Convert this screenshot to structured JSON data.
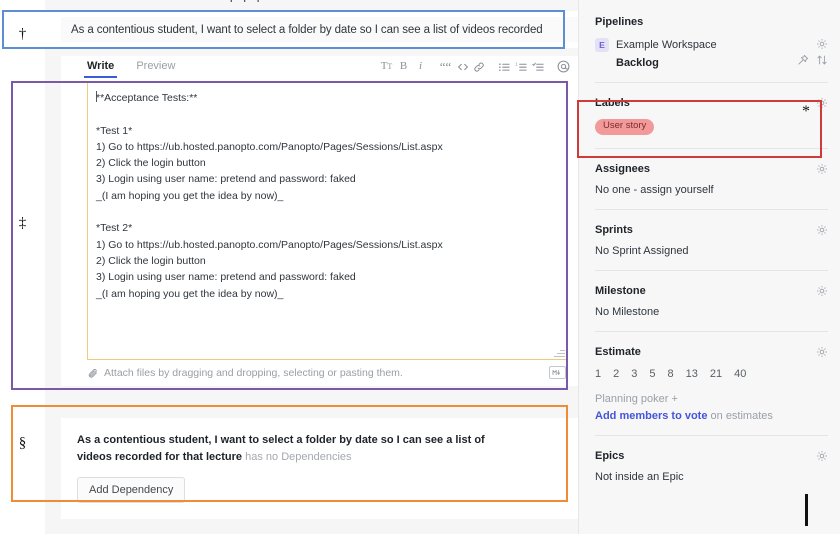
{
  "issue": {
    "title": "As a contentious student, I want to select a folder by date so I can see a list of videos recorded"
  },
  "editor": {
    "tabs": [
      {
        "label": "Write",
        "active": true
      },
      {
        "label": "Preview",
        "active": false
      }
    ],
    "toolbar": [
      {
        "name": "heading-icon",
        "glyph": "Tᴛ"
      },
      {
        "name": "bold-icon",
        "glyph": "B"
      },
      {
        "name": "italic-icon",
        "glyph": "i"
      },
      {
        "name": "quote-icon",
        "glyph": "““"
      },
      {
        "name": "code-icon",
        "glyph": "<>"
      },
      {
        "name": "link-icon",
        "glyph": "&"
      },
      {
        "name": "bulleted-list-icon",
        "glyph": "•≡"
      },
      {
        "name": "numbered-list-icon",
        "glyph": "1≡"
      },
      {
        "name": "task-list-icon",
        "glyph": "✓≡"
      },
      {
        "name": "mention-icon",
        "glyph": "@"
      }
    ],
    "body": "**Acceptance Tests:**\n\n*Test 1*\n1) Go to https://ub.hosted.panopto.com/Panopto/Pages/Sessions/List.aspx\n2) Click the login button\n3) Login using user name: pretend and password: faked\n_(I am hoping you get the idea by now)_\n\n*Test 2*\n1) Go to https://ub.hosted.panopto.com/Panopto/Pages/Sessions/List.aspx\n2) Click the login button\n3) Login using user name: pretend and password: faked\n_(I am hoping you get the idea by now)_",
    "attach_text": "Attach files by dragging and dropping, selecting or pasting them."
  },
  "dependencies": {
    "issue_title": "As a contentious student, I want to select a folder by date so I can see a list of videos recorded for that lecture",
    "status_text": "has no Dependencies",
    "add_button": "Add Dependency"
  },
  "sidebar": {
    "pipelines": {
      "title": "Pipelines",
      "workspace_initial": "E",
      "workspace": "Example Workspace",
      "status": "Backlog"
    },
    "labels": {
      "title": "Labels",
      "items": [
        {
          "name": "User story",
          "bg": "#f29a9a",
          "fg": "#7d2b2b"
        }
      ]
    },
    "assignees": {
      "title": "Assignees",
      "value": "No one - assign yourself"
    },
    "sprints": {
      "title": "Sprints",
      "value": "No Sprint Assigned"
    },
    "milestone": {
      "title": "Milestone",
      "value": "No Milestone"
    },
    "estimate": {
      "title": "Estimate",
      "values": [
        "1",
        "2",
        "3",
        "5",
        "8",
        "13",
        "21",
        "40"
      ],
      "poker_label": "Planning poker  +",
      "poker_link": "Add members to vote",
      "poker_rest": " on estimates"
    },
    "epics": {
      "title": "Epics",
      "value": "Not inside an Epic"
    }
  },
  "annotations": {
    "dagger": "†",
    "double_dagger": "‡",
    "section": "§",
    "asterisk": "*",
    "colors": {
      "blue": "#5b8ed2",
      "purple": "#7a5aa8",
      "orange": "#f08c35",
      "red": "#cf3b39"
    }
  }
}
